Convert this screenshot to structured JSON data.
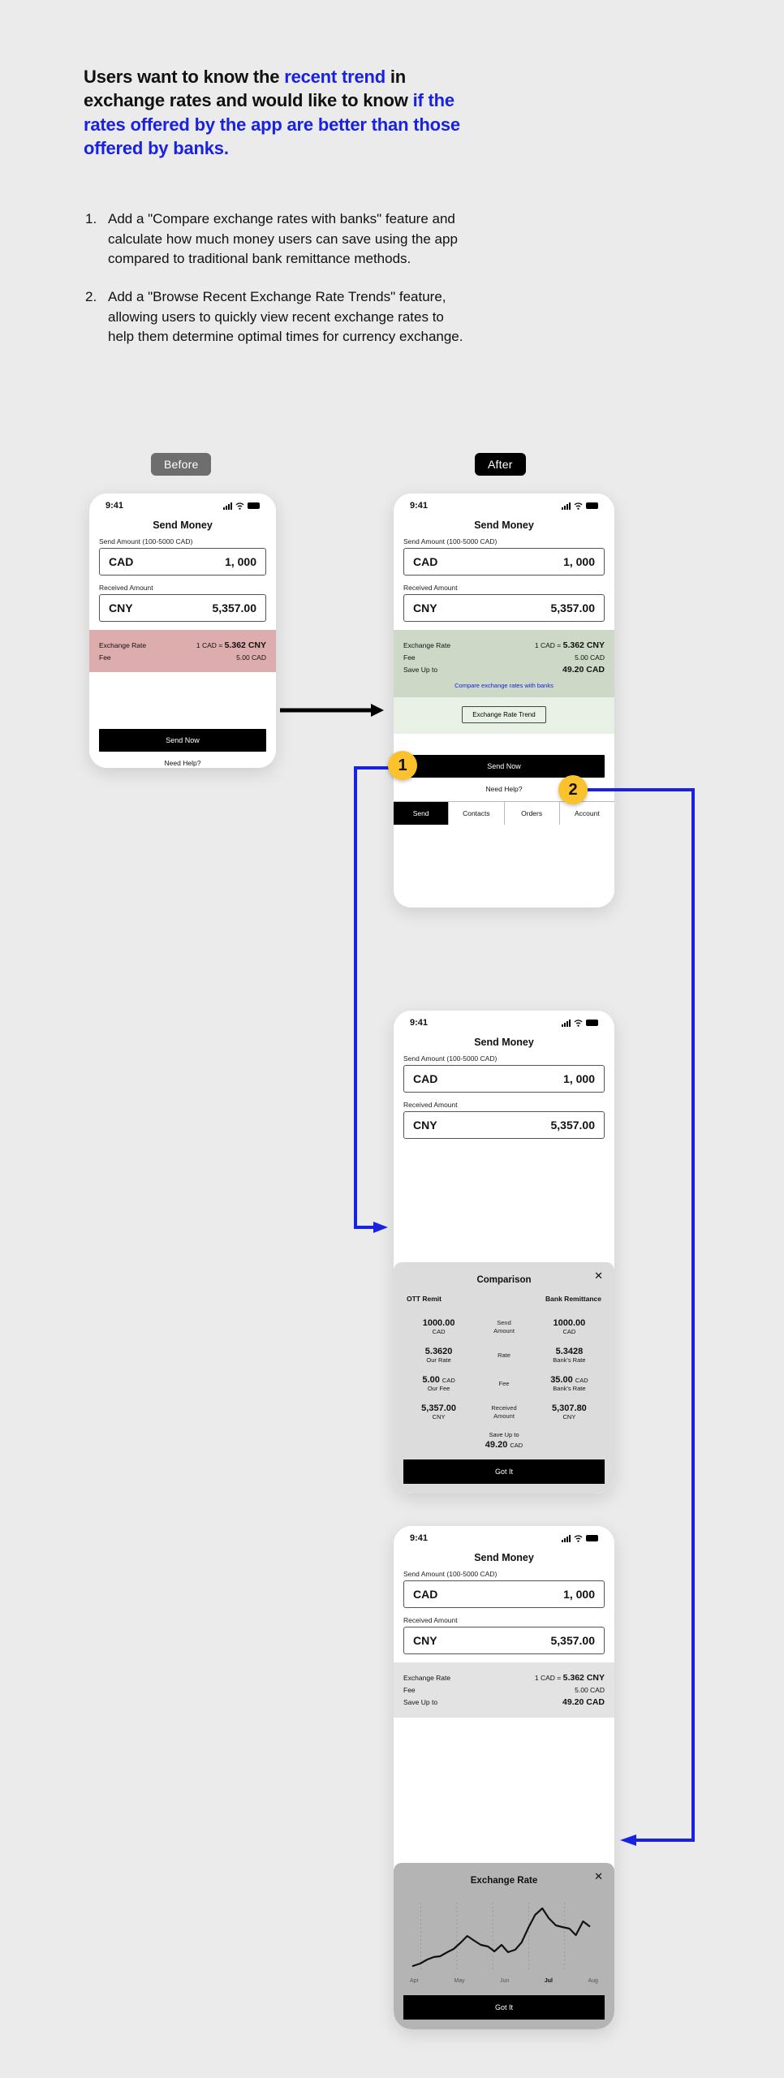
{
  "headline": {
    "part1": "Users want to know the ",
    "emph1": "recent trend",
    "part2": " in exchange rates and would like to know ",
    "emph2": "if the rates offered by the app are better than those offered by banks."
  },
  "requirements": [
    {
      "num": "1.",
      "text": "Add a \"Compare exchange rates with banks\" feature and calculate how much money users can save using the app compared to traditional bank remittance methods."
    },
    {
      "num": "2.",
      "text": "Add a \"Browse Recent Exchange Rate Trends\" feature, allowing users to quickly view recent exchange rates to help them determine optimal times for currency exchange."
    }
  ],
  "labels": {
    "before": "Before",
    "after": "After"
  },
  "annotations": {
    "badge1": "1",
    "badge2": "2"
  },
  "colors": {
    "accent_blue": "#1822e0",
    "badge_yellow": "#fcc22e",
    "pink_block": "#ddacac",
    "green_block": "#cdd9c6",
    "trend_zone": "#e9f1e6",
    "page_bg": "#ebebeb"
  },
  "phone": {
    "status_time": "9:41",
    "title": "Send Money",
    "send_label": "Send Amount (100-5000 CAD)",
    "send_currency": "CAD",
    "send_value": "1, 000",
    "received_label": "Received Amount",
    "received_currency": "CNY",
    "received_value": "5,357.00",
    "send_now": "Send Now",
    "need_help": "Need Help?",
    "tabs": [
      {
        "label": "Send",
        "active": true
      },
      {
        "label": "Contacts",
        "active": false
      },
      {
        "label": "Orders",
        "active": false
      },
      {
        "label": "Account",
        "active": false
      }
    ]
  },
  "rate_before": {
    "exchange_rate_label": "Exchange Rate",
    "exchange_rate_prefix": "1 CAD = ",
    "exchange_rate_value": "5.362 CNY",
    "fee_label": "Fee",
    "fee_value": "5.00 CAD"
  },
  "rate_after": {
    "exchange_rate_label": "Exchange Rate",
    "exchange_rate_prefix": "1 CAD = ",
    "exchange_rate_value": "5.362 CNY",
    "fee_label": "Fee",
    "fee_value": "5.00 CAD",
    "save_label": "Save Up to",
    "save_value": "49.20 CAD",
    "compare_link": "Compare exchange rates with banks",
    "trend_button": "Exchange Rate Trend"
  },
  "comparison": {
    "title": "Comparison",
    "close_icon": "close-icon",
    "col_left": "OTT Remit",
    "col_right": "Bank Remittance",
    "rows": [
      {
        "left_value": "1000.00",
        "left_unit": "",
        "left_sub": "CAD",
        "middle": "Send\nAmount",
        "right_value": "1000.00",
        "right_unit": "",
        "right_sub": "CAD"
      },
      {
        "left_value": "5.3620",
        "left_unit": "",
        "left_sub": "Our Rate",
        "middle": "Rate",
        "right_value": "5.3428",
        "right_unit": "",
        "right_sub": "Bank's Rate"
      },
      {
        "left_value": "5.00",
        "left_unit": "CAD",
        "left_sub": "Our Fee",
        "middle": "Fee",
        "right_value": "35.00",
        "right_unit": "CAD",
        "right_sub": "Bank's Rate"
      },
      {
        "left_value": "5,357.00",
        "left_unit": "",
        "left_sub": "CNY",
        "middle": "Received\nAmount",
        "right_value": "5,307.80",
        "right_unit": "",
        "right_sub": "CNY"
      }
    ],
    "save_label": "Save Up to",
    "save_value": "49.20",
    "save_unit": "CAD",
    "cta": "Got It"
  },
  "trend_modal": {
    "title": "Exchange Rate",
    "close_icon": "close-icon",
    "cta": "Got It"
  },
  "chart_data": {
    "type": "line",
    "title": "Exchange Rate",
    "xlabel": "",
    "ylabel": "",
    "grid": true,
    "legend": null,
    "tick_labels": [
      "Apr",
      "May",
      "Jun",
      "Jul",
      "Aug"
    ],
    "highlighted_tick": "Jul",
    "x": [
      0,
      1,
      2,
      3,
      4,
      5,
      6,
      7,
      8,
      9,
      10,
      11,
      12,
      13,
      14,
      15,
      16,
      17,
      18,
      19,
      20,
      21,
      22,
      23,
      24,
      25,
      26
    ],
    "values": [
      5.27,
      5.28,
      5.3,
      5.31,
      5.315,
      5.33,
      5.345,
      5.37,
      5.4,
      5.38,
      5.365,
      5.36,
      5.34,
      5.365,
      5.335,
      5.345,
      5.37,
      5.44,
      5.5,
      5.53,
      5.49,
      5.455,
      5.45,
      5.445,
      5.42,
      5.47,
      5.455
    ],
    "ylim": [
      5.24,
      5.55
    ]
  }
}
